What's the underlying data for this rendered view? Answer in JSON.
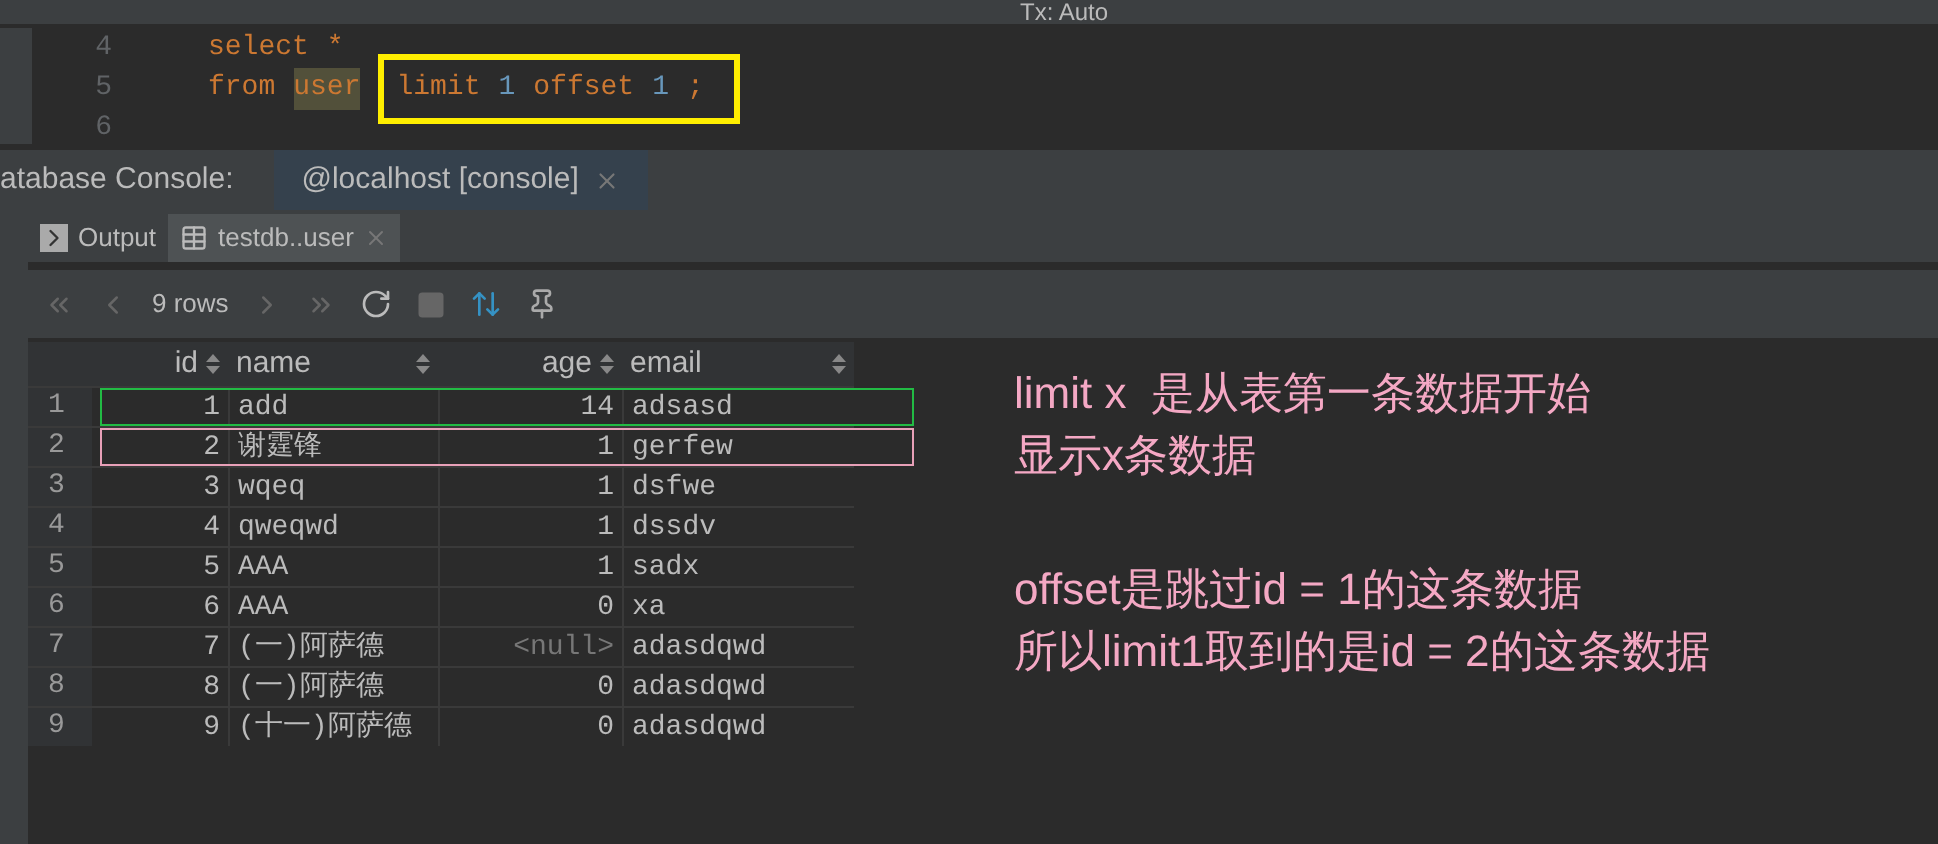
{
  "toolbar": {
    "transaction": "Tx: Auto"
  },
  "editor": {
    "lines": [
      {
        "number": "4",
        "tokens": [
          {
            "text": "select",
            "kind": "keyword",
            "in_box": false
          },
          {
            "text": "*",
            "kind": "star",
            "in_box": false
          }
        ]
      },
      {
        "number": "5",
        "tokens": [
          {
            "text": "from",
            "kind": "keyword",
            "in_box": false
          },
          {
            "text": "user",
            "kind": "table",
            "in_box": false
          },
          {
            "text": "limit",
            "kind": "keyword",
            "in_box": true
          },
          {
            "text": "1",
            "kind": "number",
            "in_box": true
          },
          {
            "text": "offset",
            "kind": "keyword",
            "in_box": true
          },
          {
            "text": "1",
            "kind": "number",
            "in_box": true
          },
          {
            "text": ";",
            "kind": "keyword",
            "in_box": true
          }
        ]
      },
      {
        "number": "6"
      }
    ]
  },
  "console_bar": {
    "label": "atabase Console:",
    "tabs": [
      {
        "label": "@localhost [console]",
        "selected": true
      }
    ]
  },
  "result_tabs": [
    {
      "label": "Output",
      "kind": "output",
      "selected": false
    },
    {
      "label": "testdb..user",
      "kind": "table",
      "selected": true
    }
  ],
  "result_toolbar": {
    "rows": "9 rows"
  },
  "table": {
    "columns": [
      "id",
      "name",
      "age",
      "email"
    ],
    "rows": [
      {
        "number": "1",
        "id": "1",
        "name": "add",
        "age": "14",
        "age_null": false,
        "email": "adsasd",
        "outlined": true,
        "color": "#22bb44"
      },
      {
        "number": "2",
        "id": "2",
        "name": "谢霆锋",
        "age": "1",
        "age_null": false,
        "email": "gerfew",
        "outlined": true,
        "color": "#e8a0b8"
      },
      {
        "number": "3",
        "id": "3",
        "name": "wqeq",
        "age": "1",
        "age_null": false,
        "email": "dsfwe",
        "outlined": false
      },
      {
        "number": "4",
        "id": "4",
        "name": "qweqwd",
        "age": "1",
        "age_null": false,
        "email": "dssdv",
        "outlined": false
      },
      {
        "number": "5",
        "id": "5",
        "name": "AAA",
        "age": "1",
        "age_null": false,
        "email": "sadx",
        "outlined": false
      },
      {
        "number": "6",
        "id": "6",
        "name": "AAA",
        "age": "0",
        "age_null": false,
        "email": "xa",
        "outlined": false
      },
      {
        "number": "7",
        "id": "7",
        "name": "(一)阿萨德",
        "age": "<null>",
        "age_null": true,
        "email": "adasdqwd",
        "outlined": false
      },
      {
        "number": "8",
        "id": "8",
        "name": "(一)阿萨德",
        "age": "0",
        "age_null": false,
        "email": "adasdqwd",
        "outlined": false
      },
      {
        "number": "9",
        "id": "9",
        "name": "(十一)阿萨德",
        "age": "0",
        "age_null": false,
        "email": "adasdqwd",
        "outlined": false
      }
    ]
  },
  "notes": [
    {
      "lines": [
        "limit x  是从表第一条数据开始",
        "显示x条数据"
      ]
    },
    {
      "lines": [
        "offset是跳过id = 1的这条数据",
        "所以limit1取到的是id = 2的这条数据"
      ]
    }
  ]
}
